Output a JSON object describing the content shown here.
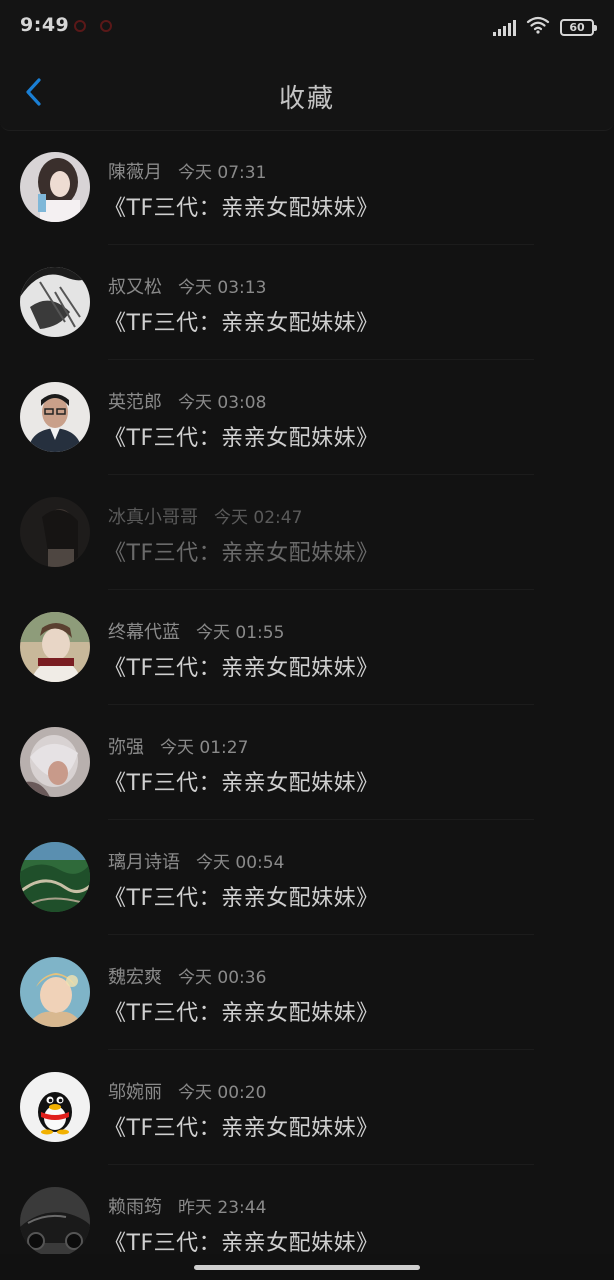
{
  "status_bar": {
    "time": "9:49",
    "battery": "60",
    "icons": [
      "notification-icon",
      "notification-icon",
      "signal-icon",
      "wifi-icon",
      "battery-icon"
    ]
  },
  "header": {
    "title": "收藏",
    "back_icon": "chevron-left-icon",
    "accent_color": "#1a7fd4"
  },
  "favorites": [
    {
      "name": "陳薇月",
      "time": "今天 07:31",
      "title": "《TF三代：亲亲女配妹妹》"
    },
    {
      "name": "叔又松",
      "time": "今天 03:13",
      "title": "《TF三代：亲亲女配妹妹》"
    },
    {
      "name": "英范郎",
      "time": "今天 03:08",
      "title": "《TF三代：亲亲女配妹妹》"
    },
    {
      "name": "冰真小哥哥",
      "time": "今天 02:47",
      "title": "《TF三代：亲亲女配妹妹》"
    },
    {
      "name": "终幕代蓝",
      "time": "今天 01:55",
      "title": "《TF三代：亲亲女配妹妹》"
    },
    {
      "name": "弥强",
      "time": "今天 01:27",
      "title": "《TF三代：亲亲女配妹妹》"
    },
    {
      "name": "璃月诗语",
      "time": "今天 00:54",
      "title": "《TF三代：亲亲女配妹妹》"
    },
    {
      "name": "魏宏爽",
      "time": "今天 00:36",
      "title": "《TF三代：亲亲女配妹妹》"
    },
    {
      "name": "邬婉丽",
      "time": "今天 00:20",
      "title": "《TF三代：亲亲女配妹妹》"
    },
    {
      "name": "赖雨筠",
      "time": "昨天 23:44",
      "title": "《TF三代：亲亲女配妹妹》"
    }
  ]
}
